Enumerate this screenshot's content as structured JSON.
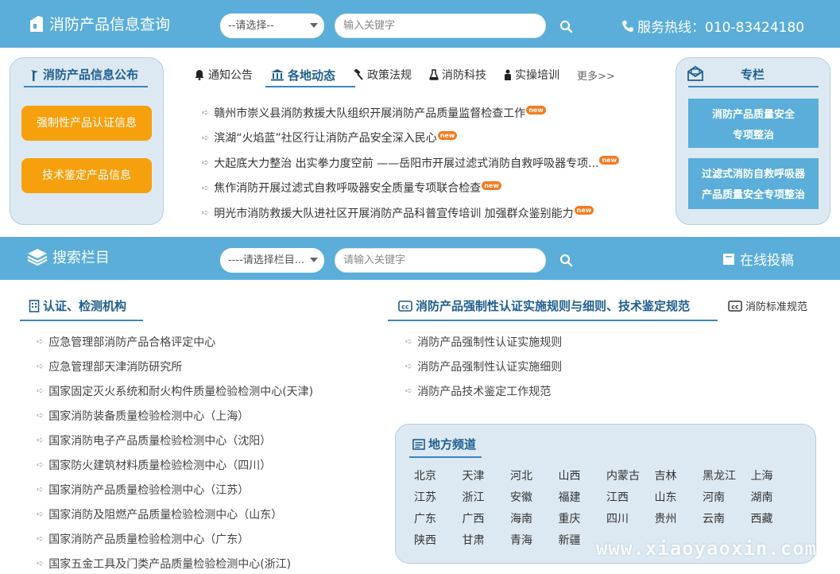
{
  "header": {
    "logo_text": "消防产品信息查询",
    "select_text": "--请选择--",
    "search_placeholder": "输入关键字",
    "hotline": "服务热线：010-83424180"
  },
  "left_panel": {
    "title": "消防产品信息公布",
    "buttons": [
      "强制性产品认证信息",
      "技术鉴定产品信息"
    ]
  },
  "tabs": {
    "items": [
      "通知公告",
      "各地动态",
      "政策法规",
      "消防科技",
      "实操培训"
    ],
    "active_index": 1,
    "more": "更多>>"
  },
  "news": [
    "赣州市崇义县消防救援大队组织开展消防产品质量监督检查工作",
    "滨湖“火焰蓝”社区行让消防产品安全深入民心",
    "大起底大力整治 出实拳力度空前 ——岳阳市开展过滤式消防自救呼吸器专项...",
    "焦作消防开展过滤式自救呼吸器安全质量专项联合检查",
    "明光市消防救援大队进社区开展消防产品科普宣传培训 加强群众鉴别能力"
  ],
  "new_badge": "new",
  "right_panel": {
    "title": "专栏",
    "items": [
      {
        "line1": "消防产品质量安全",
        "line2": "专项整治"
      },
      {
        "line1": "过滤式消防自救呼吸器",
        "line2": "产品质量安全专项整治"
      }
    ]
  },
  "bar2": {
    "title": "搜索栏目",
    "select_text": "----请选择栏目...",
    "search_placeholder": "请输入关键字",
    "submit": "在线投稿"
  },
  "institutions": {
    "title": "认证、检测机构",
    "items": [
      "应急管理部消防产品合格评定中心",
      "应急管理部天津消防研究所",
      "国家固定灭火系统和耐火构件质量检验检测中心(天津)",
      "国家消防装备质量检验检测中心（上海）",
      "国家消防电子产品质量检验检测中心（沈阳）",
      "国家防火建筑材料质量检验检测中心（四川）",
      "国家消防产品质量检验检测中心（江苏）",
      "国家消防及阻燃产品质量检验检测中心（山东）",
      "国家消防产品质量检验检测中心（广东）",
      "国家五金工具及门类产品质量检验检测中心(浙江)"
    ]
  },
  "rules": {
    "title": "消防产品强制性认证实施规则与细则、技术鉴定规范",
    "side_title": "消防标准规范",
    "items": [
      "消防产品强制性认证实施规则",
      "消防产品强制性认证实施细则",
      "消防产品技术鉴定工作规范"
    ]
  },
  "regions": {
    "title": "地方频道",
    "items": [
      "北京",
      "天津",
      "河北",
      "山西",
      "内蒙古",
      "吉林",
      "黑龙江",
      "上海",
      "江苏",
      "浙江",
      "安徽",
      "福建",
      "江西",
      "山东",
      "河南",
      "湖南",
      "广东",
      "广西",
      "海南",
      "重庆",
      "四川",
      "贵州",
      "云南",
      "西藏",
      "陕西",
      "甘肃",
      "青海",
      "新疆"
    ]
  },
  "watermark": "www.xiaoyaoxin.com",
  "colors": {
    "primary": "#5aaed9",
    "panel_bg": "#dde9f2",
    "orange": "#f5a00c",
    "title_blue": "#1f5f8f"
  }
}
